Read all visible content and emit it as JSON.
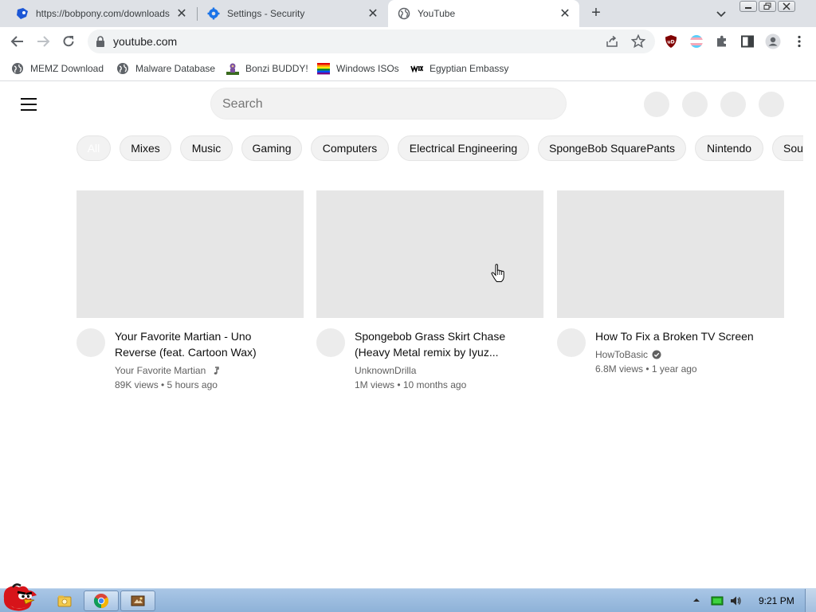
{
  "browser": {
    "tabs": [
      {
        "title": "https://bobpony.com/downloads",
        "icon": "sonic-favicon-icon",
        "active": false
      },
      {
        "title": "Settings - Security",
        "icon": "settings-gear-icon",
        "active": false
      },
      {
        "title": "YouTube",
        "icon": "globe-icon",
        "active": true
      }
    ],
    "new_tab": "+",
    "address": "youtube.com",
    "bookmarks": [
      {
        "label": "MEMZ Download",
        "icon": "globe-icon"
      },
      {
        "label": "Malware Database",
        "icon": "globe-icon"
      },
      {
        "label": "Bonzi BUDDY!",
        "icon": "bonzi-icon"
      },
      {
        "label": "Windows ISOs",
        "icon": "rainbow-flag-icon"
      },
      {
        "label": "Egyptian Embassy",
        "icon": "wix-icon"
      }
    ],
    "accent": "#1a73e8"
  },
  "youtube": {
    "search_placeholder": "Search",
    "chips": [
      "All",
      "Mixes",
      "Music",
      "Gaming",
      "Computers",
      "Electrical Engineering",
      "SpongeBob SquarePants",
      "Nintendo",
      "Sound"
    ],
    "videos": [
      {
        "title_line1": "Your Favorite Martian - Uno",
        "title_line2": "Reverse (feat. Cartoon Wax)",
        "channel": "Your Favorite Martian",
        "badge": "music-note-icon",
        "stats": "89K views • 5 hours ago"
      },
      {
        "title_line1": "Spongebob Grass Skirt Chase",
        "title_line2": "(Heavy Metal remix by Iyuz...",
        "channel": "UnknownDrilla",
        "badge": "",
        "stats": "1M views • 10 months ago"
      },
      {
        "title_line1": "How To Fix a Broken TV Screen",
        "title_line2": "",
        "channel": "HowToBasic",
        "badge": "verified-check-icon",
        "stats": "6.8M views • 1 year ago"
      }
    ]
  },
  "taskbar": {
    "clock": "9:21 PM",
    "color": "#9ebde0"
  }
}
